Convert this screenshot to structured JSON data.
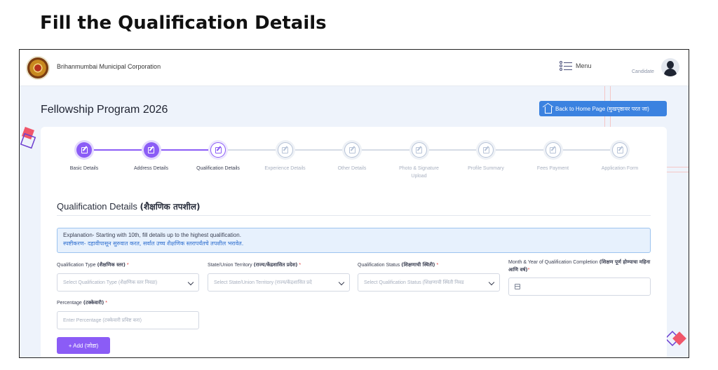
{
  "slide_title": "Fill the Qualification Details",
  "header": {
    "org_name": "Brihanmumbai Municipal Corporation",
    "menu_label": "Menu",
    "user_role": "Candidate"
  },
  "page": {
    "program_title": "Fellowship Program 2026",
    "home_button": "Back to Home Page (मुखपृष्ठावर परत जा)"
  },
  "stepper": {
    "steps": [
      {
        "label": "Basic Details",
        "status": "done"
      },
      {
        "label": "Address Details",
        "status": "done"
      },
      {
        "label": "Qualification Details",
        "status": "current"
      },
      {
        "label": "Experience Details",
        "status": "todo"
      },
      {
        "label": "Other Details",
        "status": "todo"
      },
      {
        "label": "Photo & Signature Upload",
        "status": "todo"
      },
      {
        "label": "Profile Summary",
        "status": "todo"
      },
      {
        "label": "Fees Payment",
        "status": "todo"
      },
      {
        "label": "Application Form",
        "status": "todo"
      }
    ]
  },
  "section": {
    "title_en": "Qualification Details",
    "title_mr": "(शैक्षणिक तपशील)",
    "explanation_en": "Explanation- Starting with 10th, fill details up to the highest qualification.",
    "explanation_mr": "स्पष्टीकरण- दहावीपासून सुरुवात करत, सर्वात उच्च शैक्षणिक स्तरापर्यंतचे तपशील भरावेत."
  },
  "form": {
    "qualification_type": {
      "label_en": "Qualification Type",
      "label_mr": "(शैक्षणिक स्तर)",
      "required": "*",
      "placeholder": "Select Qualification Type (शैक्षणिक स्तर निवडा)"
    },
    "state": {
      "label_en": "State/Union Territory",
      "label_mr": "(राज्य/केंद्रशासित प्रदेश)",
      "required": "*",
      "placeholder": "Select State/Union Territory (राज्य/केंद्रशासित प्रदे"
    },
    "qualification_status": {
      "label_en": "Qualification Status",
      "label_mr": "(शिक्षणाची स्थिती)",
      "required": "*",
      "placeholder": "Select Qualification Status (शिक्षणाची स्थिती निवड"
    },
    "completion_date": {
      "label_en": "Month & Year of Qualification Completion",
      "label_mr": "(शिक्षण पूर्ण होण्याचा महिना आणि वर्ष)",
      "required": "*",
      "value": ""
    },
    "percentage": {
      "label_en": "Percentage",
      "label_mr": "(टक्केवारी)",
      "required": "*",
      "placeholder": "Enter Percentage (टक्केवारी प्रविष्ट करा)"
    },
    "add_button": "+ Add (जोडा)"
  },
  "colors": {
    "accent": "#8b5cf6",
    "home_button": "#3b82e0",
    "info_bg": "#e7f1fd",
    "info_border": "#9cc3ef"
  }
}
